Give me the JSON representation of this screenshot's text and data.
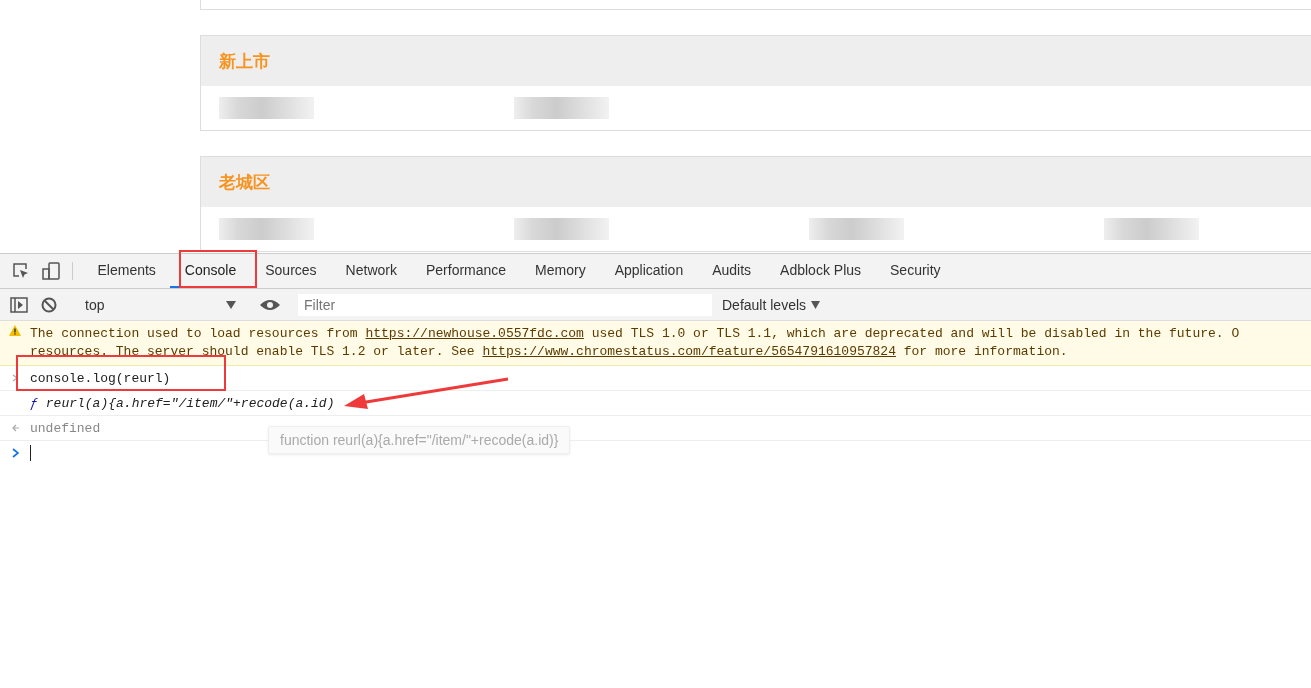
{
  "page": {
    "sections": [
      {
        "title": "新上市",
        "entries": [
          {
            "kind": "blurred"
          },
          {
            "kind": "blurred"
          }
        ]
      },
      {
        "title": "老城区",
        "entries": [
          {
            "kind": "blurred"
          },
          {
            "kind": "blurred"
          },
          {
            "kind": "blurred"
          },
          {
            "kind": "blurred"
          }
        ]
      }
    ]
  },
  "devtools": {
    "tabs": [
      {
        "label": "Elements",
        "selected": false
      },
      {
        "label": "Console",
        "selected": true
      },
      {
        "label": "Sources",
        "selected": false
      },
      {
        "label": "Network",
        "selected": false
      },
      {
        "label": "Performance",
        "selected": false
      },
      {
        "label": "Memory",
        "selected": false
      },
      {
        "label": "Application",
        "selected": false
      },
      {
        "label": "Audits",
        "selected": false
      },
      {
        "label": "Adblock Plus",
        "selected": false
      },
      {
        "label": "Security",
        "selected": false
      }
    ],
    "toolbar": {
      "context": "top",
      "filter_placeholder": "Filter",
      "levels": "Default levels"
    },
    "messages": [
      {
        "kind": "warning",
        "lines": [
          [
            {
              "kind": "text",
              "text": "The connection used to load resources from "
            },
            {
              "kind": "link",
              "text": "https://newhouse.0557fdc.com"
            },
            {
              "kind": "text",
              "text": " used TLS 1.0 or TLS 1.1, which are deprecated and will be disabled in the future. O"
            }
          ],
          [
            {
              "kind": "text",
              "text": "resources. The server should enable TLS 1.2 or later. See "
            },
            {
              "kind": "link",
              "text": "https://www.chromestatus.com/feature/5654791610957824"
            },
            {
              "kind": "text",
              "text": " for more information."
            }
          ]
        ]
      },
      {
        "kind": "input",
        "text": "console.log(reurl)"
      },
      {
        "kind": "log",
        "prefix": "ƒ",
        "text": "reurl(a){a.href=\"/item/\"+recode(a.id)"
      },
      {
        "kind": "result",
        "text": "undefined"
      },
      {
        "kind": "prompt"
      }
    ],
    "tooltip": "function reurl(a){a.href=\"/item/\"+recode(a.id)}"
  }
}
